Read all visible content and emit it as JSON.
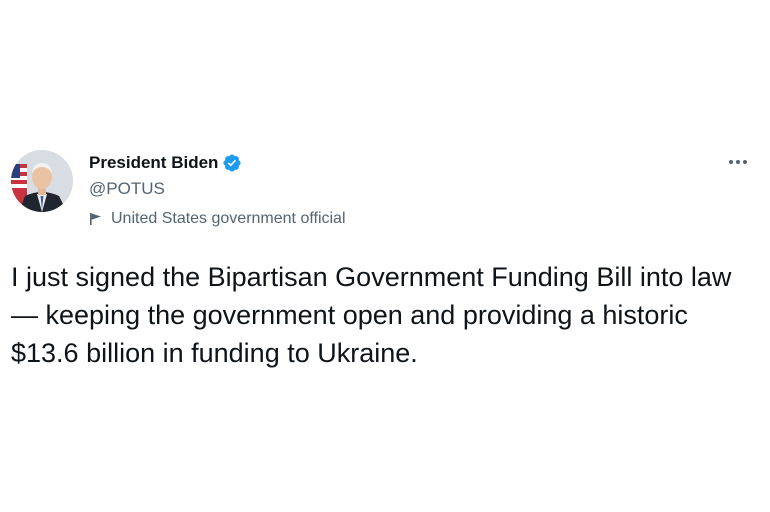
{
  "tweet": {
    "display_name": "President Biden",
    "handle": "@POTUS",
    "account_label": "United States government official",
    "text": "I just signed the Bipartisan Government Funding Bill into law — keeping the government open and providing a historic $13.6 billion in funding to Ukraine.",
    "verified": true
  },
  "icons": {
    "verified": "verified-badge-icon",
    "label": "flag-icon",
    "more": "more-horizontal-icon"
  },
  "colors": {
    "verified_blue": "#1d9bf0",
    "secondary_text": "#536471",
    "primary_text": "#0f1419"
  }
}
